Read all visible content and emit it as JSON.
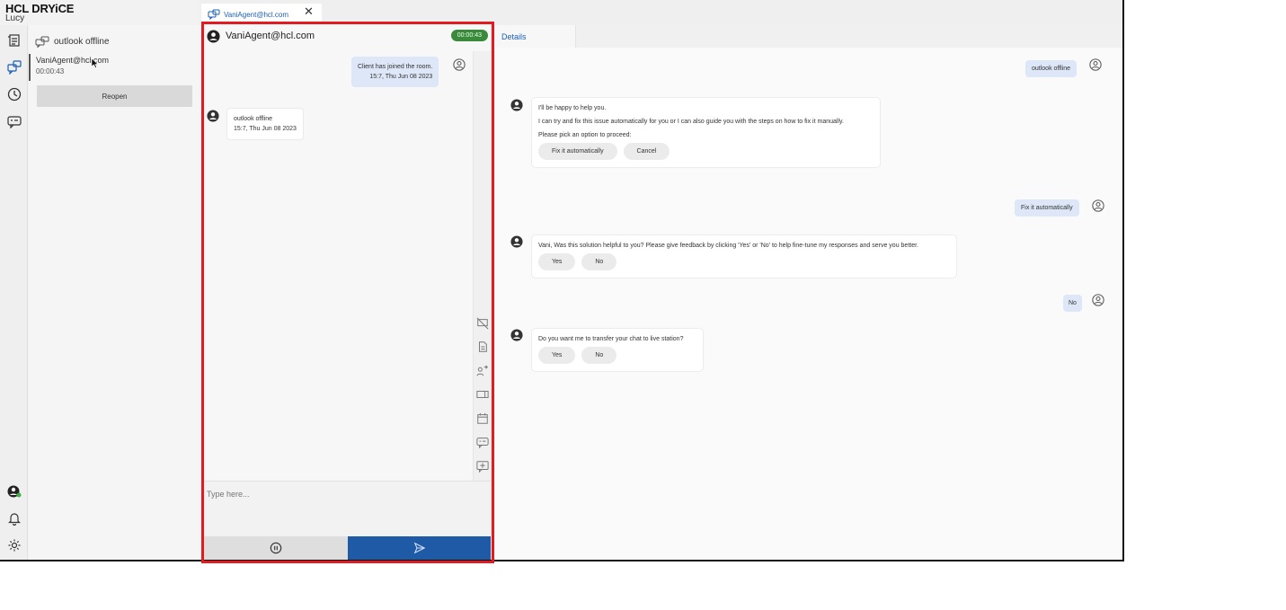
{
  "brand": {
    "name": "HCL DRYiCE",
    "user": "Lucy"
  },
  "conversation_list": {
    "header": "outlook offline",
    "item": {
      "email": "VaniAgent@hcl.com",
      "time": "00:00:43"
    },
    "reopen_label": "Reopen"
  },
  "tabs": [
    {
      "label": "VaniAgent@hcl.com",
      "close": "✕"
    }
  ],
  "chat": {
    "title": "VaniAgent@hcl.com",
    "timer": "00:00:43",
    "messages": [
      {
        "text": "Client has joined the room.",
        "time": "15:7, Thu Jun 08 2023"
      },
      {
        "text": "outlook offline",
        "time": "15:7, Thu Jun 08 2023"
      }
    ],
    "input_placeholder": "Type here..."
  },
  "details": {
    "tab_label": "Details",
    "user_msg_1": "outlook offline",
    "bot_card_1": {
      "line1": "I'll be happy to help you.",
      "line2": "I can try and fix this issue automatically for you or I can also guide you with the steps on how to fix it manually.",
      "line3": "Please pick an option to proceed:",
      "options": [
        "Fix it automatically",
        "Cancel"
      ]
    },
    "user_msg_2": "Fix it automatically",
    "bot_card_2": {
      "line1": "Vani, Was this solution helpful to you? Please give feedback by clicking 'Yes' or 'No' to help fine-tune my responses and serve you better.",
      "options": [
        "Yes",
        "No"
      ]
    },
    "user_msg_3": "No",
    "bot_card_3": {
      "line1": "Do you want me to transfer your chat to live station?",
      "options": [
        "Yes",
        "No"
      ]
    }
  }
}
